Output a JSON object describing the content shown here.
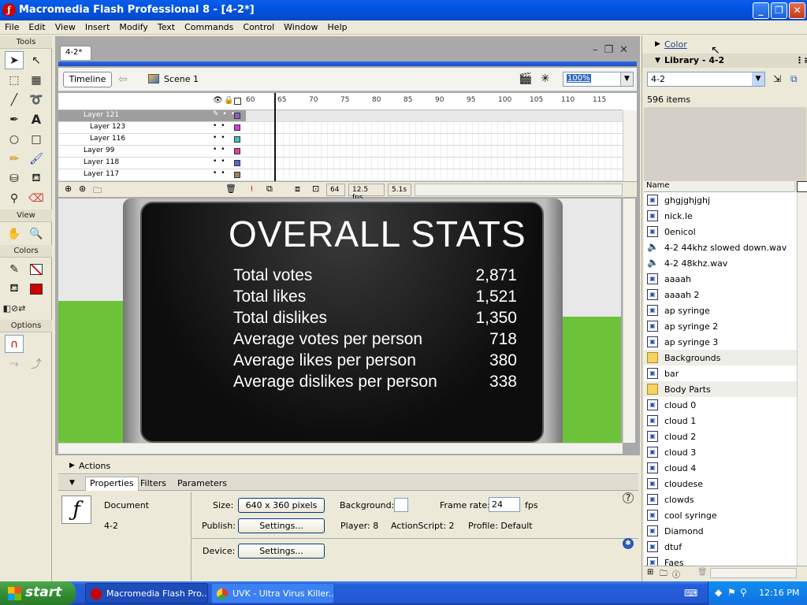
{
  "window": {
    "title": "Macromedia Flash Professional 8 - [4-2*]",
    "app_icon": "flash-icon"
  },
  "menu": [
    "File",
    "Edit",
    "View",
    "Insert",
    "Modify",
    "Text",
    "Commands",
    "Control",
    "Window",
    "Help"
  ],
  "tools": {
    "title": "Tools",
    "view_title": "View",
    "colors_title": "Colors",
    "options_title": "Options",
    "stroke_color": "#000000",
    "fill_color": "#cc0000"
  },
  "document": {
    "tab": "4-2*",
    "timeline_button": "Timeline",
    "scene": "Scene 1",
    "zoom": "100%"
  },
  "timeline": {
    "frame_numbers": [
      "60",
      "65",
      "70",
      "75",
      "80",
      "85",
      "90",
      "95",
      "100",
      "105",
      "110",
      "115"
    ],
    "layers": [
      {
        "name": "Layer 121",
        "selected": true,
        "indent": false
      },
      {
        "name": "Layer 123",
        "selected": false,
        "indent": true
      },
      {
        "name": "Layer 116",
        "selected": false,
        "indent": true
      },
      {
        "name": "Layer 99",
        "selected": false,
        "indent": false
      },
      {
        "name": "Layer 118",
        "selected": false,
        "indent": false
      },
      {
        "name": "Layer 117",
        "selected": false,
        "indent": false
      }
    ],
    "current_frame": "64",
    "fps": "12.5 fps",
    "time": "5.1s"
  },
  "stage": {
    "title": "OVERALL STATS",
    "rows": [
      {
        "label": "Total votes",
        "value": "2,871"
      },
      {
        "label": "Total likes",
        "value": "1,521"
      },
      {
        "label": "Total dislikes",
        "value": "1,350"
      },
      {
        "label": "Average votes per person",
        "value": "718"
      },
      {
        "label": "Average likes per person",
        "value": "380"
      },
      {
        "label": "Average dislikes per person",
        "value": "338"
      }
    ]
  },
  "actions_panel": {
    "label": "Actions"
  },
  "properties": {
    "tabs": [
      "Properties",
      "Filters",
      "Parameters"
    ],
    "doc_type": "Document",
    "doc_name": "4-2",
    "size_label": "Size:",
    "size_value": "640 x 360 pixels",
    "background_label": "Background:",
    "frame_rate_label": "Frame rate:",
    "frame_rate_value": "24",
    "fps_unit": "fps",
    "publish_label": "Publish:",
    "publish_settings": "Settings...",
    "player": "Player: 8",
    "actionscript": "ActionScript:  2",
    "profile": "Profile:  Default",
    "device_label": "Device:",
    "device_settings": "Settings..."
  },
  "right_panel": {
    "color_label": "Color",
    "library_label": "Library - 4-2",
    "library_select": "4-2",
    "item_count": "596 items",
    "name_header": "Name",
    "items": [
      {
        "name": "ghgjghjghj",
        "type": "symbol"
      },
      {
        "name": "nick.le",
        "type": "symbol"
      },
      {
        "name": "0enicol",
        "type": "symbol"
      },
      {
        "name": "4-2 44khz slowed down.wav",
        "type": "sound"
      },
      {
        "name": "4-2 48khz.wav",
        "type": "sound"
      },
      {
        "name": "aaaah",
        "type": "symbol"
      },
      {
        "name": "aaaah 2",
        "type": "symbol"
      },
      {
        "name": "ap syringe",
        "type": "symbol"
      },
      {
        "name": "ap syringe 2",
        "type": "symbol"
      },
      {
        "name": "ap syringe 3",
        "type": "symbol"
      },
      {
        "name": "Backgrounds",
        "type": "folder"
      },
      {
        "name": "bar",
        "type": "symbol"
      },
      {
        "name": "Body Parts",
        "type": "folder"
      },
      {
        "name": "cloud 0",
        "type": "symbol"
      },
      {
        "name": "cloud 1",
        "type": "symbol"
      },
      {
        "name": "cloud 2",
        "type": "symbol"
      },
      {
        "name": "cloud 3",
        "type": "symbol"
      },
      {
        "name": "cloud 4",
        "type": "symbol"
      },
      {
        "name": "cloudese",
        "type": "symbol"
      },
      {
        "name": "clowds",
        "type": "symbol"
      },
      {
        "name": "cool syringe",
        "type": "symbol"
      },
      {
        "name": "Diamond",
        "type": "symbol"
      },
      {
        "name": "dtuf",
        "type": "symbol"
      },
      {
        "name": "Faes",
        "type": "symbol"
      }
    ]
  },
  "taskbar": {
    "start": "start",
    "tasks": [
      {
        "label": "Macromedia Flash Pro...",
        "active": true
      },
      {
        "label": "UVK - Ultra Virus Killer...",
        "active": false
      }
    ],
    "clock": "12:16 PM"
  }
}
